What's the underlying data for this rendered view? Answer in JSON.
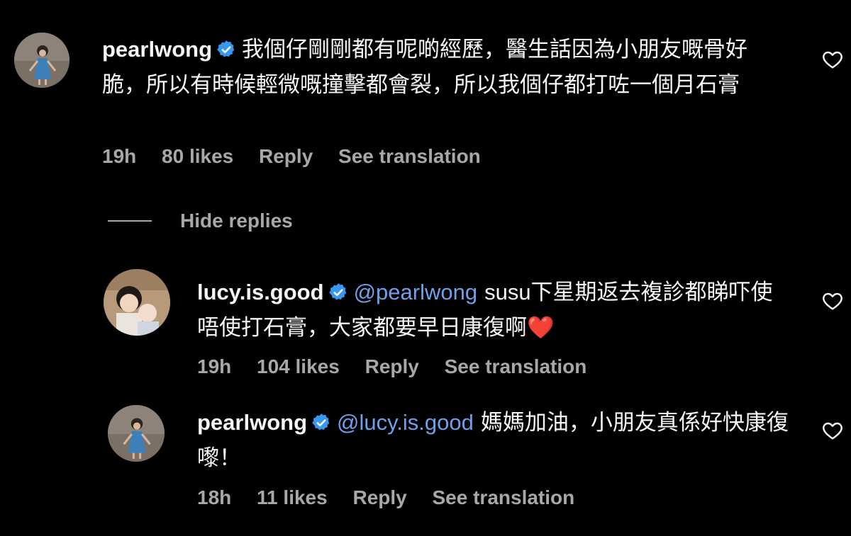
{
  "comments": [
    {
      "username": "pearlwong",
      "verified": true,
      "mention": "",
      "text": "我個仔剛剛都有呢啲經歷，醫生話因為小朋友嘅骨好脆，所以有時候輕微嘅撞擊都會裂，所以我個仔都打咗一個月石膏",
      "time": "19h",
      "likes": "80 likes",
      "reply": "Reply",
      "translation": "See translation",
      "avatar_icon": "avatar-girl-in-dress"
    },
    {
      "username": "lucy.is.good",
      "verified": true,
      "mention": "@pearlwong",
      "text": "susu下星期返去複診都睇吓使唔使打石膏，大家都要早日康復啊❤️",
      "time": "19h",
      "likes": "104 likes",
      "reply": "Reply",
      "translation": "See translation",
      "avatar_icon": "avatar-child-and-baby"
    },
    {
      "username": "pearlwong",
      "verified": true,
      "mention": "@lucy.is.good",
      "text": "媽媽加油，小朋友真係好快康復嚟！",
      "time": "18h",
      "likes": "11 likes",
      "reply": "Reply",
      "translation": "See translation",
      "avatar_icon": "avatar-girl-in-dress"
    }
  ],
  "hide_replies": "Hide replies",
  "colors": {
    "background": "#000000",
    "text": "#f5f5f5",
    "meta": "#a8a8a8",
    "mention": "#6fa0ec",
    "verified": "#3897f0"
  },
  "icons": {
    "like": "heart-outline-icon",
    "verified": "verified-badge-icon"
  }
}
